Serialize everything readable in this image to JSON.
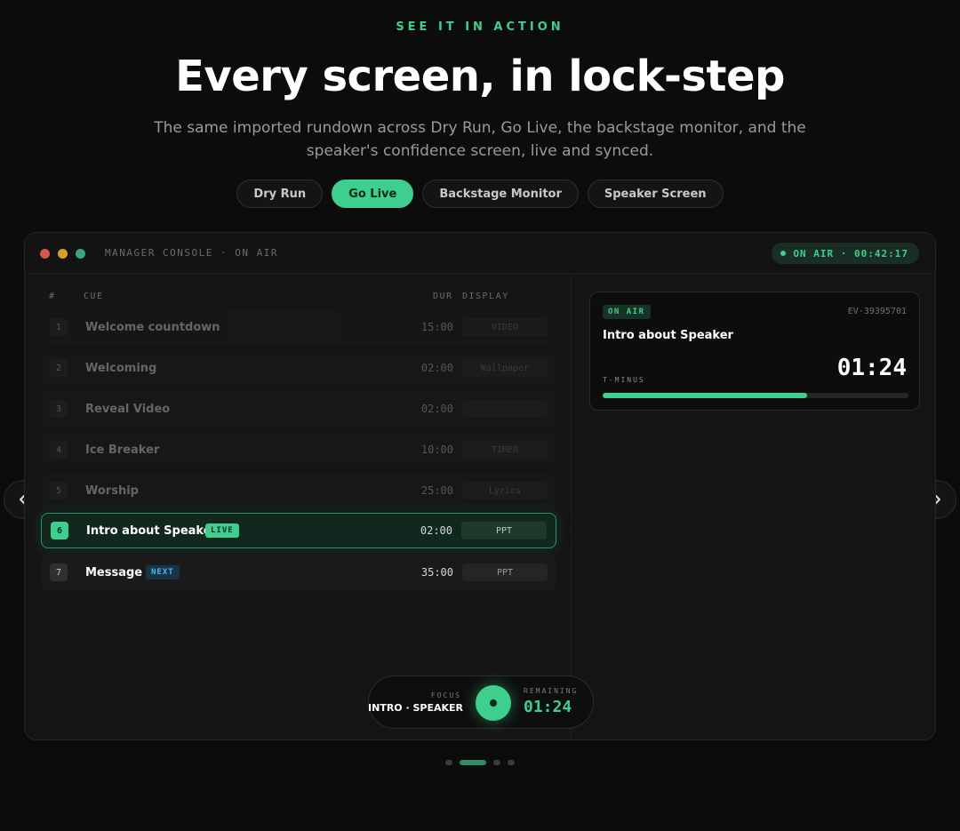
{
  "hero": {
    "eyebrow": "SEE IT IN ACTION",
    "headline": "Every screen, in lock-step",
    "subhead": "The same imported rundown across Dry Run, Go Live, the backstage monitor, and the speaker's confidence screen, live and synced."
  },
  "tabs": [
    {
      "label": "Dry Run",
      "active": false
    },
    {
      "label": "Go Live",
      "active": true
    },
    {
      "label": "Backstage Monitor",
      "active": false
    },
    {
      "label": "Speaker Screen",
      "active": false
    }
  ],
  "window": {
    "title": "MANAGER CONSOLE · ON AIR",
    "status": "ON AIR · 00:42:17"
  },
  "rundown": {
    "columns": {
      "num": "#",
      "cue": "CUE",
      "dur": "DUR",
      "display": "DISPLAY"
    },
    "rows": [
      {
        "num": "1",
        "cue": "Welcome countdown",
        "dur": "15:00",
        "display": "VIDEO",
        "state": "past"
      },
      {
        "num": "2",
        "cue": "Welcoming",
        "dur": "02:00",
        "display": "Wallpaper",
        "state": "past"
      },
      {
        "num": "3",
        "cue": "Reveal Video",
        "dur": "02:00",
        "display": "-",
        "state": "past"
      },
      {
        "num": "4",
        "cue": "Ice Breaker",
        "dur": "10:00",
        "display": "TIMER",
        "state": "past"
      },
      {
        "num": "5",
        "cue": "Worship",
        "dur": "25:00",
        "display": "Lyrics",
        "state": "past"
      },
      {
        "num": "6",
        "cue": "Intro about Speaker",
        "badge": "LIVE",
        "dur": "02:00",
        "display": "PPT",
        "state": "live"
      },
      {
        "num": "7",
        "cue": "Message",
        "badge": "NEXT",
        "dur": "35:00",
        "display": "PPT",
        "state": "next"
      }
    ]
  },
  "on_air_card": {
    "tag": "ON AIR",
    "event_id": "EV·39395701",
    "title": "Intro about Speaker",
    "time": "01:24",
    "tminus_label": "T-MINUS",
    "progress": 0.67
  },
  "focus_bar": {
    "focus_label": "FOCUS",
    "focus_value": "INTRO · SPEAKER",
    "remaining_label": "REMAINING",
    "remaining_value": "01:24"
  },
  "carousel": {
    "pages": 4,
    "active": 1
  },
  "colors": {
    "accent": "#3ecf8e",
    "next_badge": "#4fb5ef",
    "background": "#0c0c0c"
  }
}
